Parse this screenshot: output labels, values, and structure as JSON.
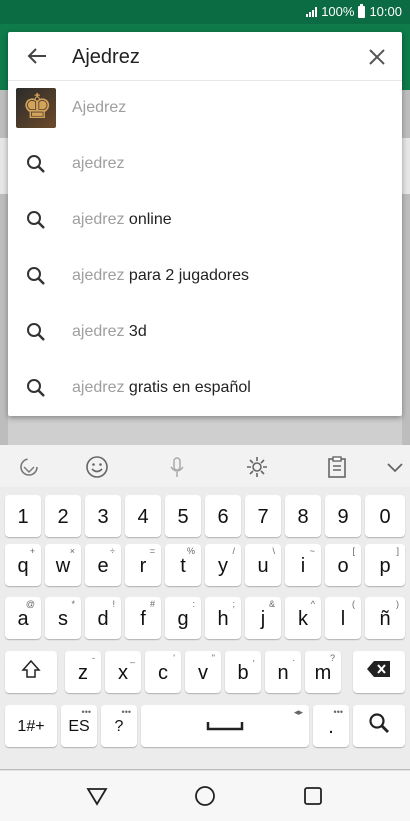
{
  "status": {
    "battery": "100%",
    "time": "10:00"
  },
  "search": {
    "query": "Ajedrez"
  },
  "suggestions": [
    {
      "type": "app",
      "prefix": "Ajedrez",
      "suffix": ""
    },
    {
      "type": "query",
      "prefix": "ajedrez",
      "suffix": ""
    },
    {
      "type": "query",
      "prefix": "ajedrez",
      "suffix": " online"
    },
    {
      "type": "query",
      "prefix": "ajedrez",
      "suffix": " para 2 jugadores"
    },
    {
      "type": "query",
      "prefix": "ajedrez",
      "suffix": " 3d"
    },
    {
      "type": "query",
      "prefix": "ajedrez",
      "suffix": " gratis en español"
    }
  ],
  "keyboard": {
    "numbers": [
      "1",
      "2",
      "3",
      "4",
      "5",
      "6",
      "7",
      "8",
      "9",
      "0"
    ],
    "row_q": [
      {
        "k": "q",
        "s": "+"
      },
      {
        "k": "w",
        "s": "×"
      },
      {
        "k": "e",
        "s": "÷"
      },
      {
        "k": "r",
        "s": "="
      },
      {
        "k": "t",
        "s": "%"
      },
      {
        "k": "y",
        "s": "/"
      },
      {
        "k": "u",
        "s": "\\"
      },
      {
        "k": "i",
        "s": "~"
      },
      {
        "k": "o",
        "s": "["
      },
      {
        "k": "p",
        "s": "]"
      }
    ],
    "row_a": [
      {
        "k": "a",
        "s": "@"
      },
      {
        "k": "s",
        "s": "*"
      },
      {
        "k": "d",
        "s": "!"
      },
      {
        "k": "f",
        "s": "#"
      },
      {
        "k": "g",
        "s": ":"
      },
      {
        "k": "h",
        "s": ";"
      },
      {
        "k": "j",
        "s": "&"
      },
      {
        "k": "k",
        "s": "^"
      },
      {
        "k": "l",
        "s": "("
      },
      {
        "k": "ñ",
        "s": ")"
      }
    ],
    "row_z": [
      {
        "k": "z",
        "s": "‐"
      },
      {
        "k": "x",
        "s": "_"
      },
      {
        "k": "c",
        "s": "'"
      },
      {
        "k": "v",
        "s": "\""
      },
      {
        "k": "b",
        "s": ","
      },
      {
        "k": "n",
        "s": "."
      },
      {
        "k": "m",
        "s": "?"
      }
    ],
    "bottom": {
      "sym": "1#+",
      "lang": "ES",
      "q": "?",
      "dot": "."
    }
  }
}
